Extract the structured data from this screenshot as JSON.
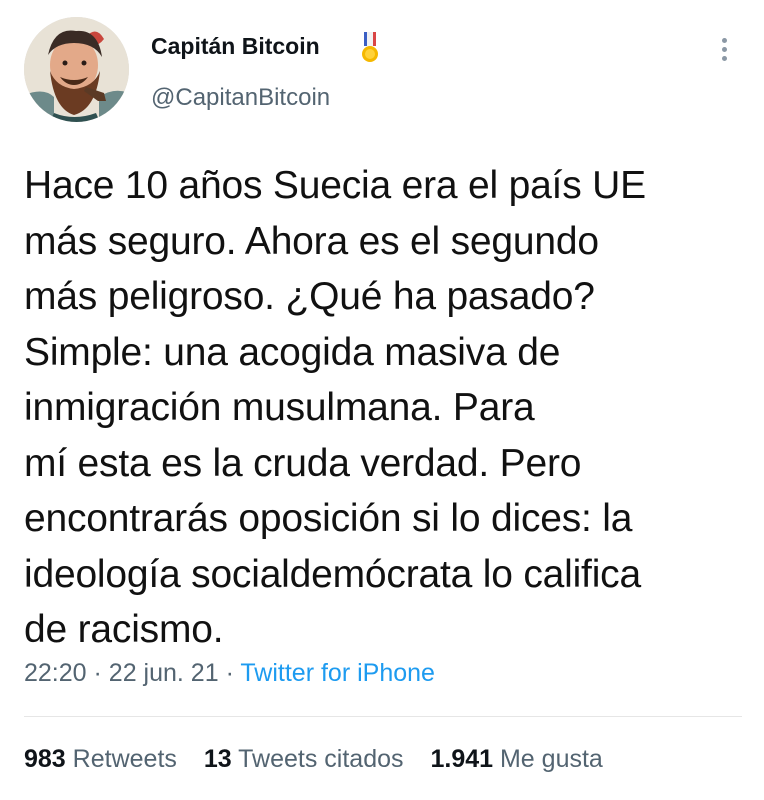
{
  "author": {
    "display_name": "Capitán Bitcoin",
    "handle": "@CapitanBitcoin",
    "badge_icon": "medal-icon"
  },
  "tweet": {
    "text": "Hace 10 años Suecia era el país UE\nmás seguro. Ahora es el segundo\nmás peligroso. ¿Qué ha pasado?\nSimple: una acogida masiva de\ninmigración musulmana. Para\nmí esta es la cruda verdad. Pero\nencontrarás oposición si lo dices: la\nideología socialdemócrata lo califica\nde racismo.",
    "time": "22:20",
    "date": "22 jun. 21",
    "source": "Twitter for iPhone"
  },
  "stats": {
    "retweets_count": "983",
    "retweets_label": "Retweets",
    "quotes_count": "13",
    "quotes_label": "Tweets citados",
    "likes_count": "1.941",
    "likes_label": "Me gusta"
  },
  "colors": {
    "link": "#1d9bf0",
    "secondary_text": "#536471",
    "primary_text": "#0f1419"
  }
}
